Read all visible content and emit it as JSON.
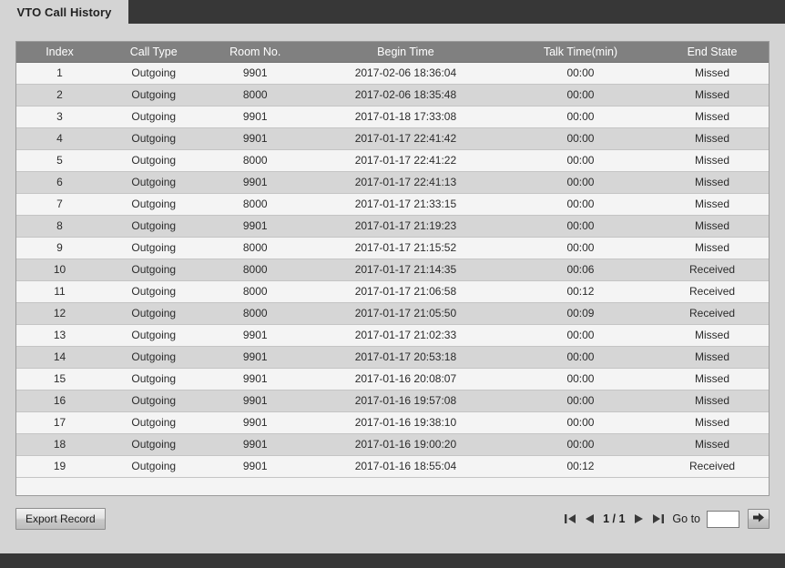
{
  "tab": {
    "label": "VTO Call History"
  },
  "table": {
    "columns": [
      "Index",
      "Call Type",
      "Room No.",
      "Begin Time",
      "Talk Time(min)",
      "End State"
    ],
    "rows": [
      {
        "index": "1",
        "call_type": "Outgoing",
        "room_no": "9901",
        "begin_time": "2017-02-06 18:36:04",
        "talk_time": "00:00",
        "end_state": "Missed"
      },
      {
        "index": "2",
        "call_type": "Outgoing",
        "room_no": "8000",
        "begin_time": "2017-02-06 18:35:48",
        "talk_time": "00:00",
        "end_state": "Missed"
      },
      {
        "index": "3",
        "call_type": "Outgoing",
        "room_no": "9901",
        "begin_time": "2017-01-18 17:33:08",
        "talk_time": "00:00",
        "end_state": "Missed"
      },
      {
        "index": "4",
        "call_type": "Outgoing",
        "room_no": "9901",
        "begin_time": "2017-01-17 22:41:42",
        "talk_time": "00:00",
        "end_state": "Missed"
      },
      {
        "index": "5",
        "call_type": "Outgoing",
        "room_no": "8000",
        "begin_time": "2017-01-17 22:41:22",
        "talk_time": "00:00",
        "end_state": "Missed"
      },
      {
        "index": "6",
        "call_type": "Outgoing",
        "room_no": "9901",
        "begin_time": "2017-01-17 22:41:13",
        "talk_time": "00:00",
        "end_state": "Missed"
      },
      {
        "index": "7",
        "call_type": "Outgoing",
        "room_no": "8000",
        "begin_time": "2017-01-17 21:33:15",
        "talk_time": "00:00",
        "end_state": "Missed"
      },
      {
        "index": "8",
        "call_type": "Outgoing",
        "room_no": "9901",
        "begin_time": "2017-01-17 21:19:23",
        "talk_time": "00:00",
        "end_state": "Missed"
      },
      {
        "index": "9",
        "call_type": "Outgoing",
        "room_no": "8000",
        "begin_time": "2017-01-17 21:15:52",
        "talk_time": "00:00",
        "end_state": "Missed"
      },
      {
        "index": "10",
        "call_type": "Outgoing",
        "room_no": "8000",
        "begin_time": "2017-01-17 21:14:35",
        "talk_time": "00:06",
        "end_state": "Received"
      },
      {
        "index": "11",
        "call_type": "Outgoing",
        "room_no": "8000",
        "begin_time": "2017-01-17 21:06:58",
        "talk_time": "00:12",
        "end_state": "Received"
      },
      {
        "index": "12",
        "call_type": "Outgoing",
        "room_no": "8000",
        "begin_time": "2017-01-17 21:05:50",
        "talk_time": "00:09",
        "end_state": "Received"
      },
      {
        "index": "13",
        "call_type": "Outgoing",
        "room_no": "9901",
        "begin_time": "2017-01-17 21:02:33",
        "talk_time": "00:00",
        "end_state": "Missed"
      },
      {
        "index": "14",
        "call_type": "Outgoing",
        "room_no": "9901",
        "begin_time": "2017-01-17 20:53:18",
        "talk_time": "00:00",
        "end_state": "Missed"
      },
      {
        "index": "15",
        "call_type": "Outgoing",
        "room_no": "9901",
        "begin_time": "2017-01-16 20:08:07",
        "talk_time": "00:00",
        "end_state": "Missed"
      },
      {
        "index": "16",
        "call_type": "Outgoing",
        "room_no": "9901",
        "begin_time": "2017-01-16 19:57:08",
        "talk_time": "00:00",
        "end_state": "Missed"
      },
      {
        "index": "17",
        "call_type": "Outgoing",
        "room_no": "9901",
        "begin_time": "2017-01-16 19:38:10",
        "talk_time": "00:00",
        "end_state": "Missed"
      },
      {
        "index": "18",
        "call_type": "Outgoing",
        "room_no": "9901",
        "begin_time": "2017-01-16 19:00:20",
        "talk_time": "00:00",
        "end_state": "Missed"
      },
      {
        "index": "19",
        "call_type": "Outgoing",
        "room_no": "9901",
        "begin_time": "2017-01-16 18:55:04",
        "talk_time": "00:12",
        "end_state": "Received"
      }
    ]
  },
  "toolbar": {
    "export_label": "Export Record"
  },
  "pager": {
    "first_icon": "first-page-icon",
    "prev_icon": "previous-page-icon",
    "page_label": "1 / 1",
    "next_icon": "next-page-icon",
    "last_icon": "last-page-icon",
    "goto_label": "Go to",
    "goto_value": "",
    "goto_placeholder": "",
    "go_icon": "go-arrow-icon"
  },
  "colors": {
    "page_background": "#d4d4d4",
    "chrome_dark": "#373737",
    "table_header": "#808080",
    "row_odd": "#f4f4f4",
    "row_even": "#d6d6d6",
    "text": "#2b2b2b"
  }
}
